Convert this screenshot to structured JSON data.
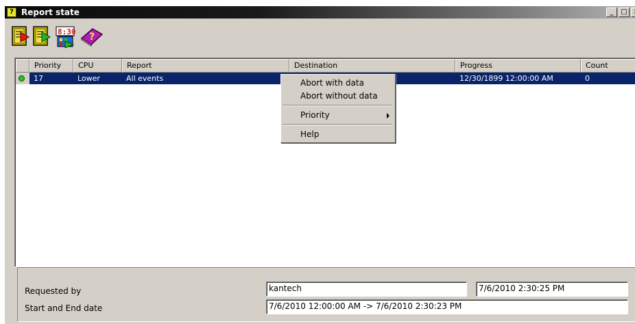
{
  "window": {
    "title": "Report state",
    "controls": {
      "minimize": "_",
      "maximize": "□",
      "close": "×"
    }
  },
  "toolbar": {
    "tools": [
      {
        "icon": "report-stop-icon"
      },
      {
        "icon": "report-start-icon"
      },
      {
        "icon": "schedule-clock-icon",
        "clock_text": "8:30"
      },
      {
        "icon": "help-book-icon"
      }
    ]
  },
  "table": {
    "columns": [
      "Priority",
      "CPU",
      "Report",
      "Destination",
      "Progress",
      "Count"
    ],
    "rows": [
      {
        "status": "green",
        "priority": "17",
        "cpu": "Lower",
        "report": "All events",
        "destination": "",
        "progress": "12/30/1899 12:00:00 AM",
        "count": "0"
      }
    ]
  },
  "context_menu": {
    "abort_with_data": "Abort with data",
    "abort_without_data": "Abort without data",
    "priority": "Priority",
    "help": "Help"
  },
  "details": {
    "requested_by_label": "Requested by",
    "requested_by_value": "kantech",
    "requested_time": "7/6/2010 2:30:25 PM",
    "start_end_label": "Start and End date",
    "start_end_value": "7/6/2010 12:00:00 AM -> 7/6/2010 2:30:23 PM"
  },
  "colors": {
    "selection": "#0a246a",
    "status_green": "#22c522",
    "face": "#d4d0c8"
  }
}
